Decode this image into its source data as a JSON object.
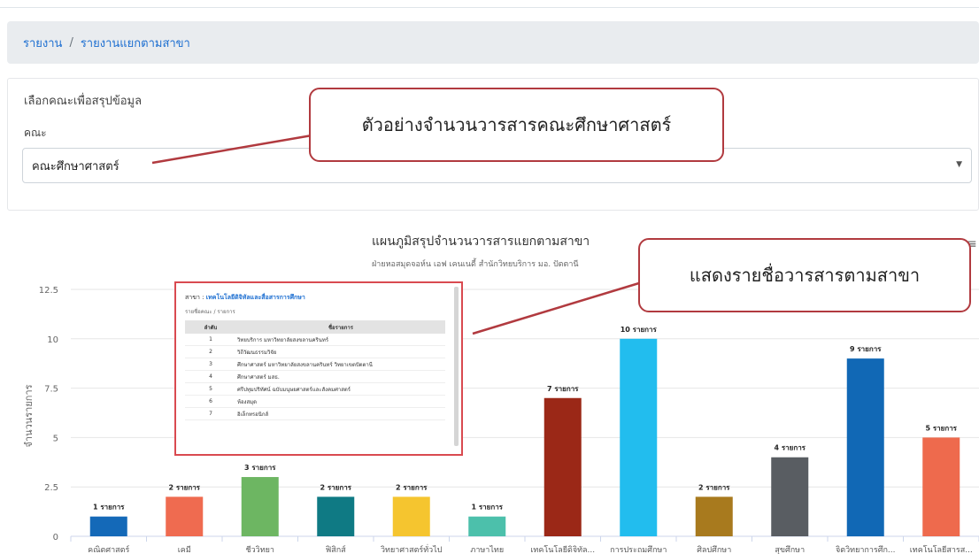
{
  "breadcrumb": {
    "items": [
      "รายงาน",
      "รายงานแยกตามสาขา"
    ],
    "separator": "/"
  },
  "filter": {
    "title": "เลือกคณะเพื่อสรุปข้อมูล",
    "label": "คณะ",
    "selected": "คณะศึกษาศาสตร์"
  },
  "callouts": {
    "faculty": "ตัวอย่างจำนวนวารสารคณะศึกษาศาสตร์",
    "popup": "แสดงรายชื่อวารสารตามสาขา"
  },
  "chart": {
    "title": "แผนภูมิสรุปจำนวนวารสารแยกตามสาขา",
    "subtitle": "ฝ่ายหอสมุดจอห์น เอฟ เคนเนดี้ สำนักวิทยบริการ มอ. ปัตตานี",
    "menu_icon": "hamburger-icon"
  },
  "chart_data": {
    "type": "bar",
    "ylabel": "จำนวนรายการ",
    "ylim": [
      0,
      12.5
    ],
    "yticks": [
      "0",
      "2.5",
      "5",
      "7.5",
      "10",
      "12.5"
    ],
    "categories": [
      "คณิตศาสตร์",
      "เคมี",
      "ชีววิทยา",
      "ฟิสิกส์",
      "วิทยาศาสตร์ทั่วไป",
      "ภาษาไทย",
      "เทคโนโลยีดิจิทัล...",
      "การประถมศึกษา",
      "ศิลปศึกษา",
      "สุขศึกษา",
      "จิตวิทยาการศึก...",
      "เทคโนโลยีสารส..."
    ],
    "values": [
      1,
      2,
      3,
      2,
      2,
      1,
      7,
      10,
      2,
      4,
      9,
      5
    ],
    "labels": [
      "1 รายการ",
      "2 รายการ",
      "3 รายการ",
      "2 รายการ",
      "2 รายการ",
      "1 รายการ",
      "7 รายการ",
      "10 รายการ",
      "2 รายการ",
      "4 รายการ",
      "9 รายการ",
      "5 รายการ"
    ],
    "colors": [
      "#1469b8",
      "#ef6b50",
      "#6db662",
      "#0f7a84",
      "#f5c52f",
      "#4cc0ab",
      "#9b2817",
      "#22bdee",
      "#a87a1e",
      "#595d62",
      "#1168b5",
      "#ee6a4d"
    ]
  },
  "popup": {
    "branch_label": "สาขา :",
    "branch_name": "เทคโนโลยีดิจิทัลและสื่อสารการศึกษา",
    "breadcrumb": "รายชื่อคณะ / รายการ",
    "columns": [
      "ลำดับ",
      "ชื่อรายการ"
    ],
    "rows": [
      {
        "no": "1",
        "name": "วิทยบริการ มหาวิทยาลัยสงขลานครินทร์"
      },
      {
        "no": "2",
        "name": "วิถีวัฒนธรรมวิจัย"
      },
      {
        "no": "3",
        "name": "ศึกษาศาสตร์ มหาวิทยาลัยสงขลานครินทร์ วิทยาเขตปัตตานี"
      },
      {
        "no": "4",
        "name": "ศึกษาศาสตร์ มสธ."
      },
      {
        "no": "5",
        "name": "ศรีปทุมปริทัศน์ ฉบับมนุษยศาสตร์และสังคมศาสตร์"
      },
      {
        "no": "6",
        "name": "ห้องสมุด"
      },
      {
        "no": "7",
        "name": "อิเล็กทรอนิกส์"
      }
    ]
  }
}
